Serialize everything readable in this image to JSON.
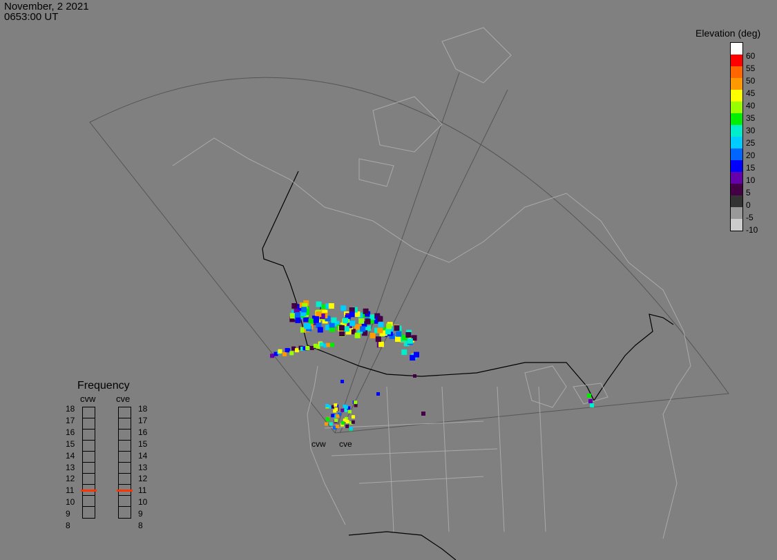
{
  "header": {
    "date": "November, 2 2021",
    "time": "0653:00 UT"
  },
  "colorbar": {
    "title": "Elevation (deg)",
    "labels": [
      "60",
      "55",
      "50",
      "45",
      "40",
      "35",
      "30",
      "25",
      "20",
      "15",
      "10",
      "5",
      "0",
      "-5",
      "-10"
    ],
    "colors": [
      "#ffffff",
      "#ff0000",
      "#ff6600",
      "#ff9900",
      "#ffff00",
      "#99ff00",
      "#00ee00",
      "#00eecc",
      "#00ccff",
      "#0066ff",
      "#0000ff",
      "#6600aa",
      "#440044",
      "#333333",
      "#999999",
      "#cccccc"
    ]
  },
  "frequency": {
    "title": "Frequency",
    "radars": [
      {
        "name": "cvw",
        "selected_mhz": 11
      },
      {
        "name": "cve",
        "selected_mhz": 11
      }
    ],
    "labels": [
      "18",
      "17",
      "16",
      "15",
      "14",
      "13",
      "12",
      "11",
      "10",
      "9",
      "8"
    ]
  },
  "radar_sites": [
    "cvw",
    "cve"
  ]
}
